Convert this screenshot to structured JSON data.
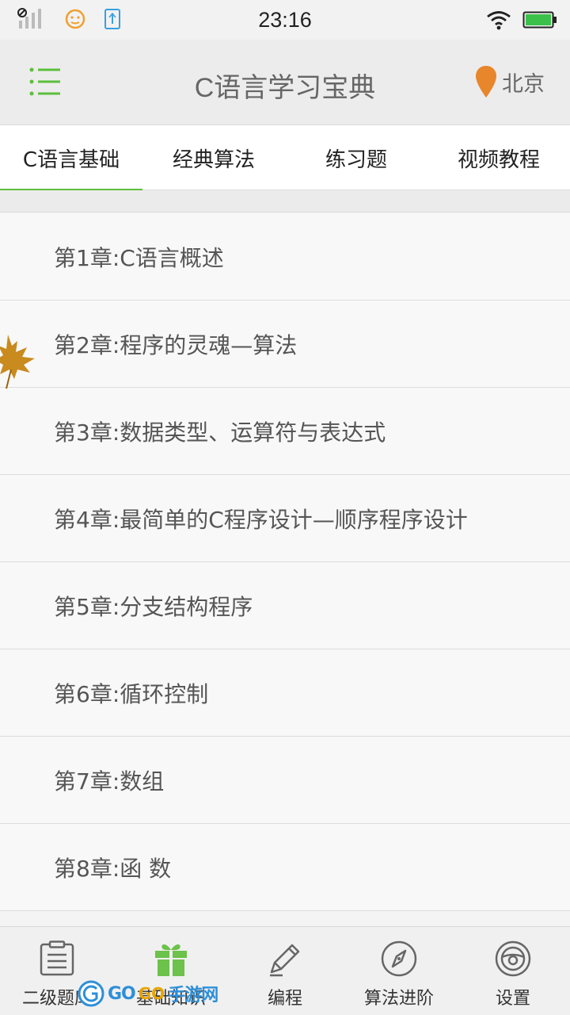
{
  "status_bar": {
    "time": "23:16",
    "icons": [
      "signal-off-icon",
      "face-icon",
      "usb-icon",
      "wifi-icon",
      "battery-icon"
    ]
  },
  "header": {
    "title": "C语言学习宝典",
    "location": "北京",
    "accent_color": "#5cbf3a",
    "pin_color": "#e8862c"
  },
  "tabs": [
    {
      "label": "C语言基础",
      "active": true
    },
    {
      "label": "经典算法",
      "active": false
    },
    {
      "label": "练习题",
      "active": false
    },
    {
      "label": "视频教程",
      "active": false
    }
  ],
  "chapters": [
    "第1章:C语言概述",
    "第2章:程序的灵魂—算法",
    "第3章:数据类型、运算符与表达式",
    "第4章:最简单的C程序设计—顺序程序设计",
    "第5章:分支结构程序",
    "第6章:循环控制",
    "第7章:数组",
    "第8章:函 数"
  ],
  "bottom_nav": [
    {
      "label": "二级题库",
      "icon": "clipboard-icon"
    },
    {
      "label": "基础知识",
      "icon": "gift-icon"
    },
    {
      "label": "编程",
      "icon": "pencil-icon"
    },
    {
      "label": "算法进阶",
      "icon": "compass-icon"
    },
    {
      "label": "设置",
      "icon": "steering-wheel-icon"
    }
  ],
  "watermark": {
    "text_a": "GO",
    "text_b": "GO",
    "text_c": "手游网"
  }
}
